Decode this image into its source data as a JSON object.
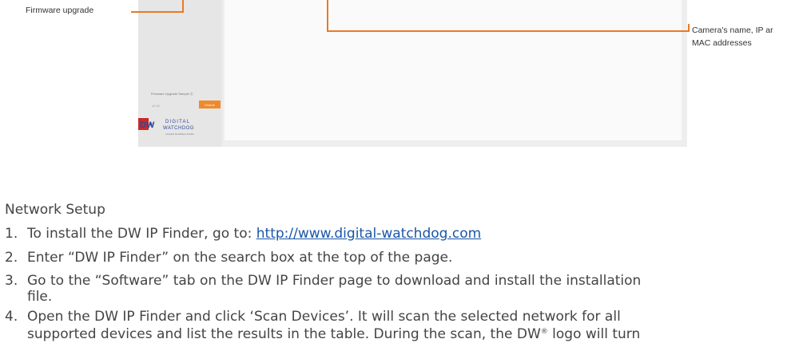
{
  "callouts": {
    "firmware": "Firmware upgrade",
    "camera_line1": "Camera's name, IP ar",
    "camera_line2": "MAC addresses"
  },
  "screenshot": {
    "sidebar_label": "Firmware Upgrade Sample Ⓒ",
    "sidebar_value": "v2.10",
    "sidebar_button": "Search",
    "logo": {
      "mark": "DW",
      "brand": "DIGITAL WATCHDOG",
      "tagline": "Complete Surveillance Solution"
    },
    "colors": {
      "accent": "#ef8a2c",
      "brand_blue": "#2b4a9a",
      "brand_red": "#c62a2a"
    }
  },
  "section": {
    "title": "Network Setup",
    "steps": [
      {
        "num": "1.",
        "text": "To install the DW IP Finder, go to: ",
        "link": "http://www.digital-watchdog.com"
      },
      {
        "num": "2.",
        "text": "Enter “DW IP Finder” on the search box at the top of the page."
      },
      {
        "num": "3.",
        "text": "Go to the “Software” tab on the DW IP Finder page to download and install the installation",
        "cont": "file."
      },
      {
        "num": "4.",
        "text": "Open the DW IP Finder and click ‘Scan Devices’. It will scan the selected network for all",
        "cont_a": "supported devices and list the results in the table. During the scan, the DW",
        "cont_sup": "®",
        "cont_b": " logo will turn"
      }
    ]
  }
}
